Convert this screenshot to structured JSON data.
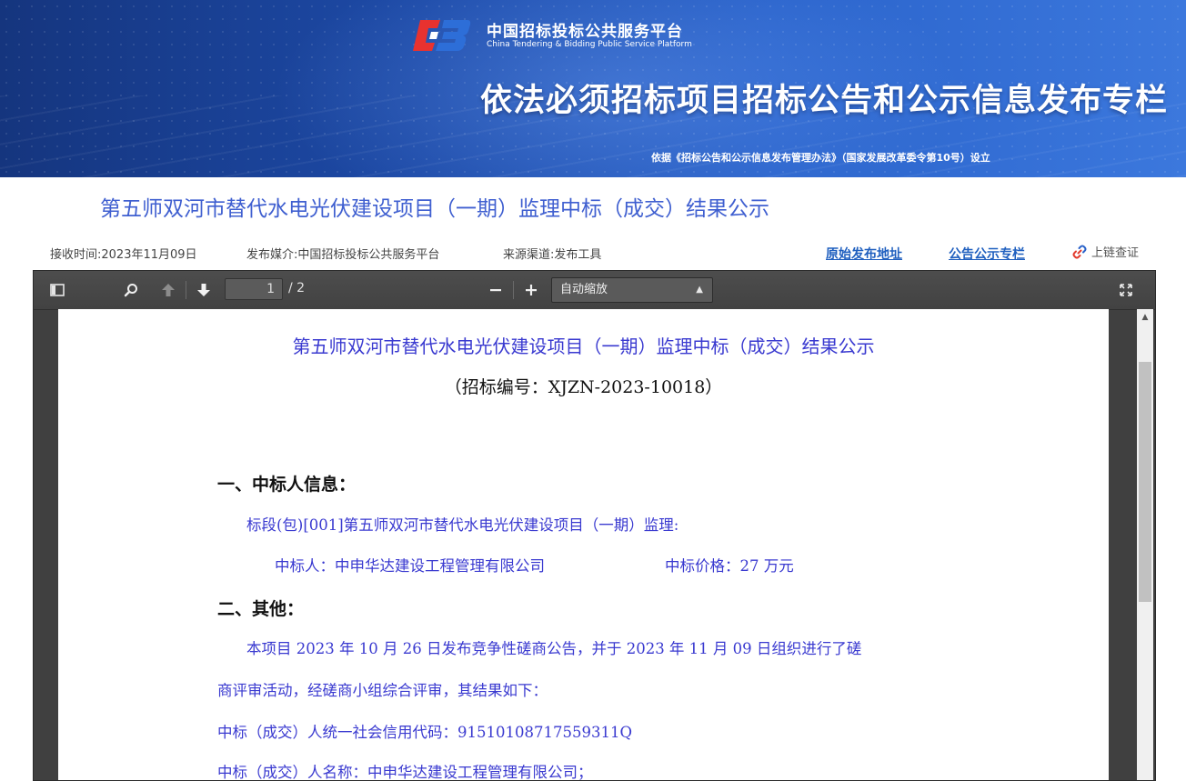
{
  "banner": {
    "logo_cn": "中国招标投标公共服务平台",
    "logo_en": "China Tendering & Bidding Public Service Platform",
    "title": "依法必须招标项目招标公告和公示信息发布专栏",
    "subtitle": "依据《招标公告和公示信息发布管理办法》（国家发展改革委令第10号）设立"
  },
  "notice": {
    "title": "第五师双河市替代水电光伏建设项目（一期）监理中标（成交）结果公示"
  },
  "meta": {
    "received": "接收时间:2023年11月09日",
    "media": "发布媒介:中国招标投标公共服务平台",
    "channel": "来源渠道:发布工具",
    "link_original": "原始发布地址",
    "link_column": "公告公示专栏",
    "chain_check": "上链查证"
  },
  "viewer": {
    "page_current": "1",
    "page_total": "/ 2",
    "zoom": "自动缩放",
    "icons": [
      "sidebar-toggle-icon",
      "search-icon",
      "arrow-up-icon",
      "arrow-down-icon",
      "minus-icon",
      "plus-icon",
      "fullscreen-icon"
    ]
  },
  "doc": {
    "title": "第五师双河市替代水电光伏建设项目（一期）监理中标（成交）结果公示",
    "code": "（招标编号：XJZN-2023-10018）",
    "section1": "一、中标人信息：",
    "lot": "标段(包)[001]第五师双河市替代水电光伏建设项目（一期）监理:",
    "winner": "中标人：中申华达建设工程管理有限公司",
    "price": "中标价格：27 万元",
    "section2": "二、其他：",
    "para1": "本项目 2023 年 10 月 26 日发布竞争性磋商公告，并于 2023 年 11 月 09 日组织进行了磋",
    "para2": "商评审活动，经磋商小组综合评审，其结果如下：",
    "credit": "中标（成交）人统一社会信用代码：91510108717559311Q",
    "name": "中标（成交）人名称：中申华达建设工程管理有限公司；"
  },
  "colors": {
    "banner_start": "#15357e",
    "banner_end": "#3c78dd",
    "title_blue": "#3f5fd0",
    "link_blue": "#1f5fbf",
    "doc_blue": "#3a3ad0",
    "logo_red": "#e8322f"
  }
}
